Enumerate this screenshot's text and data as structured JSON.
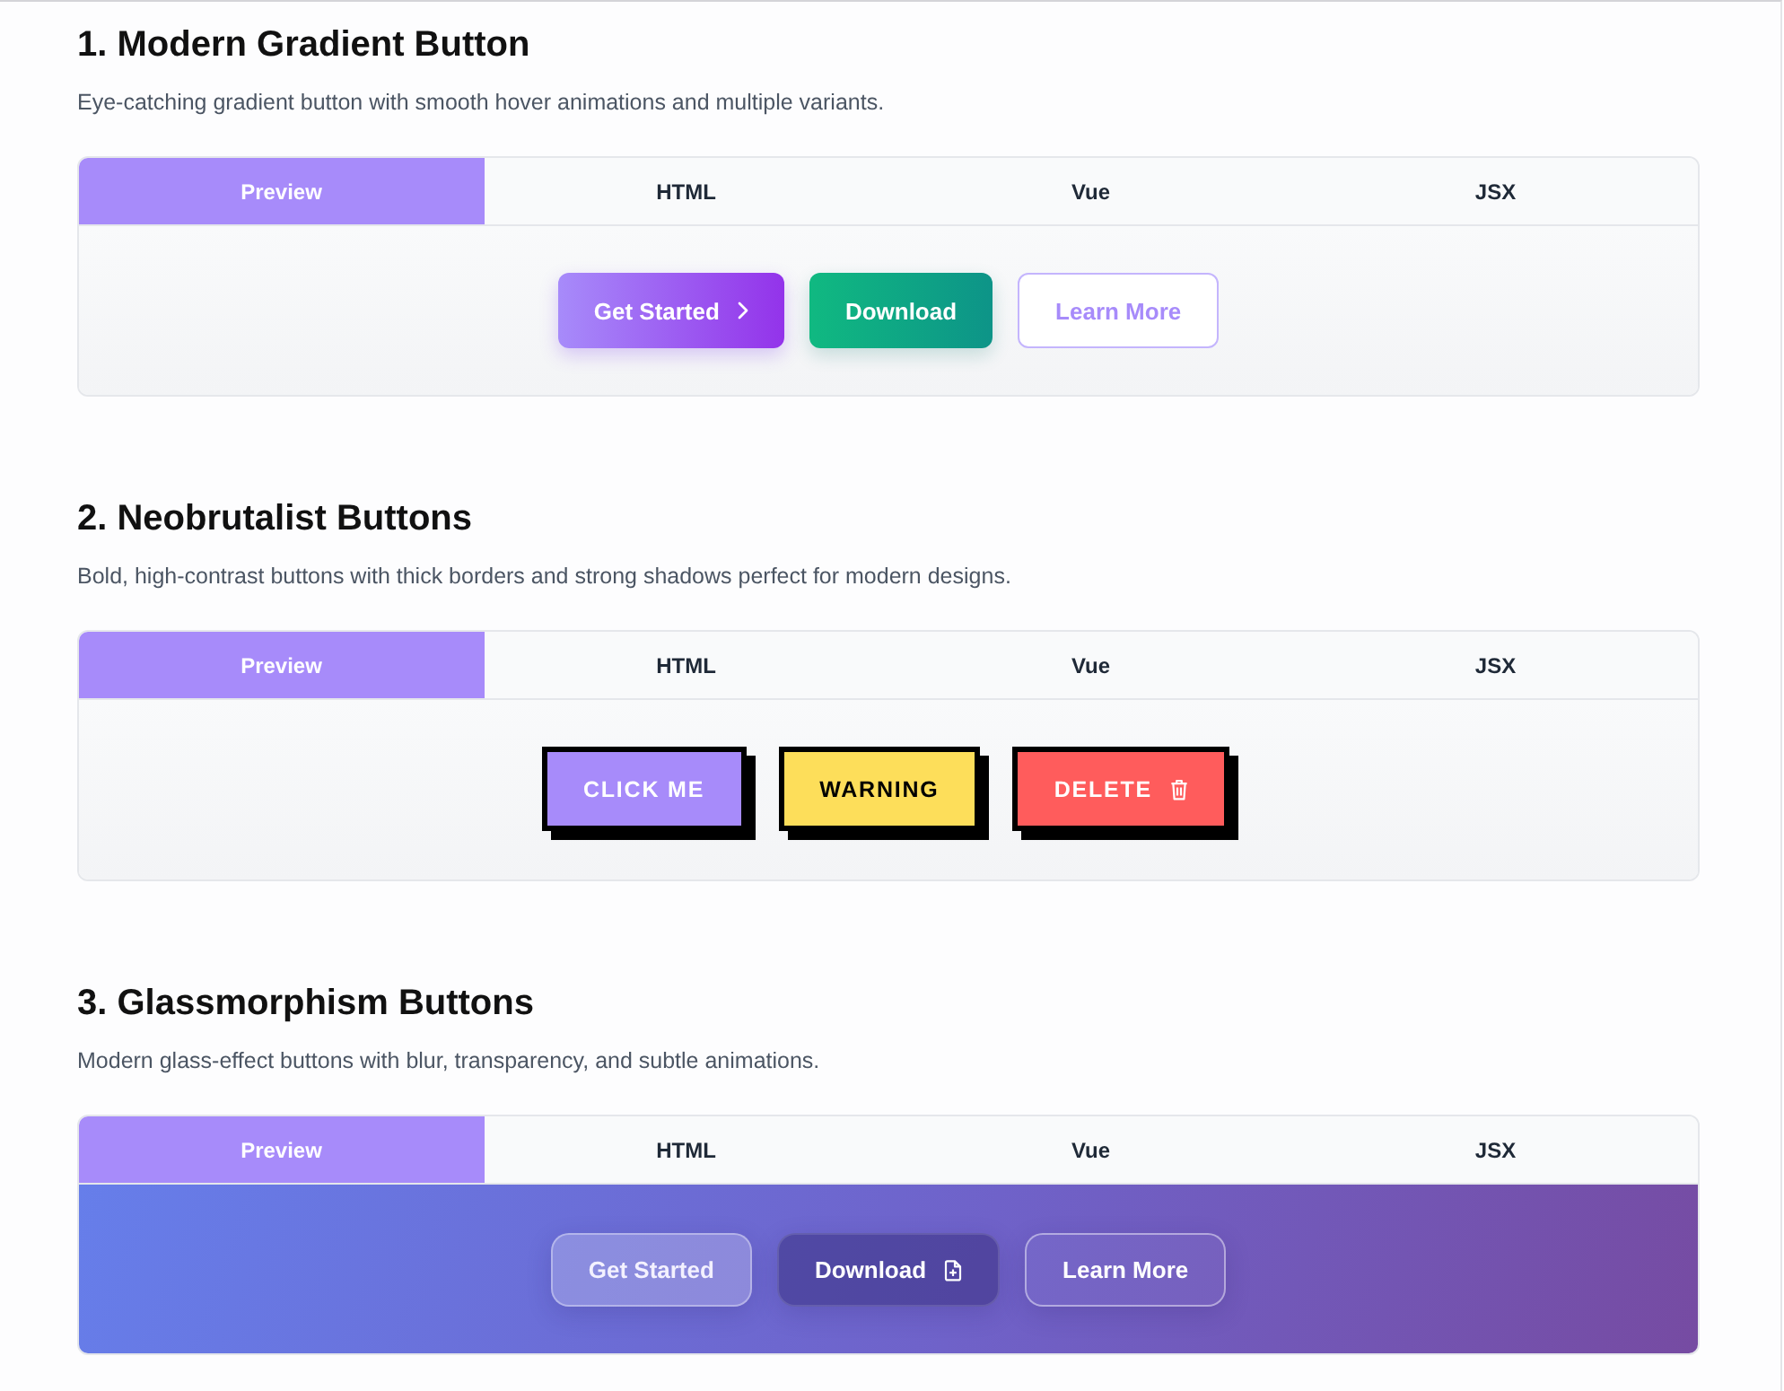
{
  "sections": [
    {
      "title": "1. Modern Gradient Button",
      "description": "Eye-catching gradient button with smooth hover animations and multiple variants.",
      "tabs": [
        {
          "label": "Preview",
          "selected": true
        },
        {
          "label": "HTML",
          "selected": false
        },
        {
          "label": "Vue",
          "selected": false
        },
        {
          "label": "JSX",
          "selected": false
        }
      ],
      "preview": {
        "kind": "gradient",
        "buttons": [
          {
            "label": "Get Started"
          },
          {
            "label": "Download"
          },
          {
            "label": "Learn More"
          }
        ]
      }
    },
    {
      "title": "2. Neobrutalist Buttons",
      "description": "Bold, high-contrast buttons with thick borders and strong shadows perfect for modern designs.",
      "tabs": [
        {
          "label": "Preview",
          "selected": true
        },
        {
          "label": "HTML",
          "selected": false
        },
        {
          "label": "Vue",
          "selected": false
        },
        {
          "label": "JSX",
          "selected": false
        }
      ],
      "preview": {
        "kind": "neobrutalist",
        "buttons": [
          {
            "label": "CLICK ME"
          },
          {
            "label": "WARNING"
          },
          {
            "label": "DELETE"
          }
        ]
      }
    },
    {
      "title": "3. Glassmorphism Buttons",
      "description": "Modern glass-effect buttons with blur, transparency, and subtle animations.",
      "tabs": [
        {
          "label": "Preview",
          "selected": true
        },
        {
          "label": "HTML",
          "selected": false
        },
        {
          "label": "Vue",
          "selected": false
        },
        {
          "label": "JSX",
          "selected": false
        }
      ],
      "preview": {
        "kind": "glass",
        "buttons": [
          {
            "label": "Get Started"
          },
          {
            "label": "Download"
          },
          {
            "label": "Learn More"
          }
        ]
      }
    }
  ]
}
